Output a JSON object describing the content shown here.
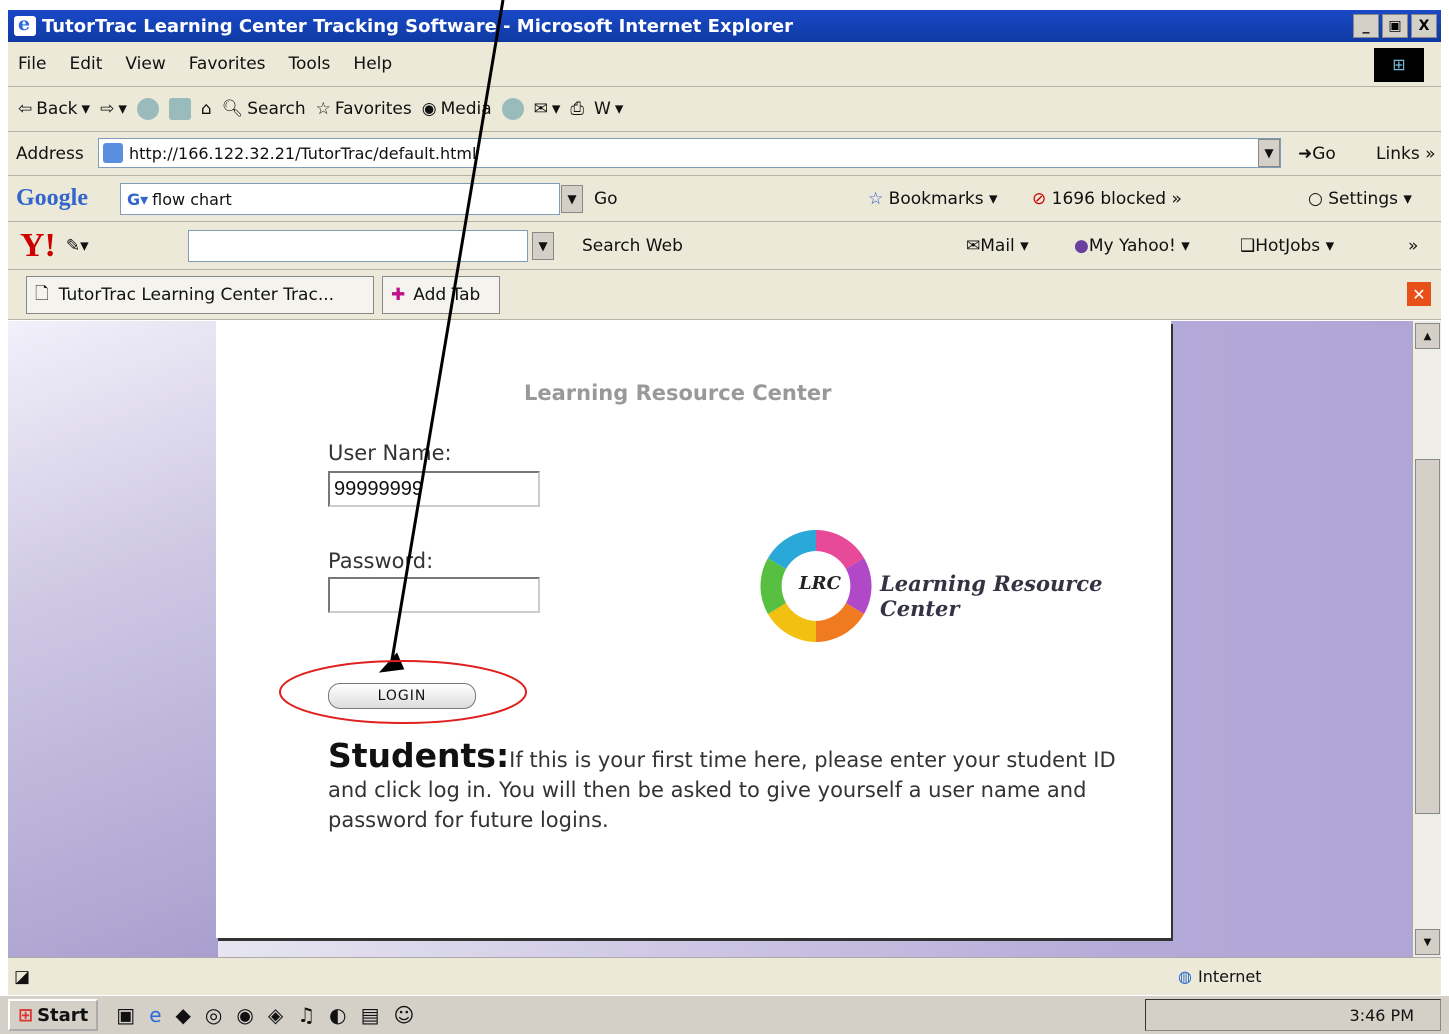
{
  "window": {
    "title": "TutorTrac Learning Center Tracking Software - Microsoft Internet Explorer",
    "minimize": "_",
    "maximize": "▣",
    "close": "X"
  },
  "menu": [
    "File",
    "Edit",
    "View",
    "Favorites",
    "Tools",
    "Help"
  ],
  "toolbar": {
    "back": "Back",
    "search": "Search",
    "favorites": "Favorites",
    "media": "Media"
  },
  "address": {
    "label": "Address",
    "url": "http://166.122.32.21/TutorTrac/default.html",
    "go": "Go",
    "links": "Links"
  },
  "google": {
    "logo": "Google",
    "query": "flow chart",
    "go": "Go",
    "bookmarks": "Bookmarks",
    "blocked": "1696 blocked",
    "settings": "Settings"
  },
  "yahoo": {
    "logo": "Y!",
    "search_web": "Search Web",
    "mail": "Mail",
    "my_yahoo": "My Yahoo!",
    "hotjobs": "HotJobs"
  },
  "tabs": {
    "current": "TutorTrac Learning Center Trac...",
    "add": "Add Tab"
  },
  "page": {
    "heading": "Learning Resource Center",
    "username_label": "User Name:",
    "username_value": "99999999",
    "password_label": "Password:",
    "login_button": "LOGIN",
    "students_heading": "Students:",
    "students_text": "If this is your first time here, please enter your student ID and click log in. You will then be asked to give yourself a user name and password for future logins.",
    "logo_abbrev": "LRC",
    "logo_text": "Learning Resource Center"
  },
  "status": {
    "zone": "Internet"
  },
  "taskbar": {
    "start": "start",
    "clock": "3:46 PM"
  }
}
